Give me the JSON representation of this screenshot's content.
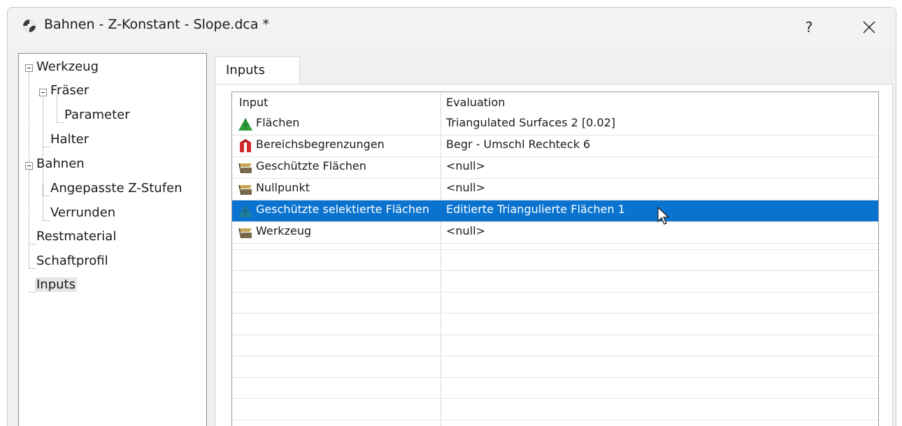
{
  "window": {
    "title": "Bahnen - Z-Konstant - Slope.dca *",
    "help_label": "?"
  },
  "tree": {
    "items": [
      {
        "label": "Werkzeug"
      },
      {
        "label": "Fräser"
      },
      {
        "label": "Parameter"
      },
      {
        "label": "Halter"
      },
      {
        "label": "Bahnen"
      },
      {
        "label": "Angepasste Z-Stufen"
      },
      {
        "label": "Verrunden"
      },
      {
        "label": "Restmaterial"
      },
      {
        "label": "Schaftprofil"
      },
      {
        "label": "Inputs"
      }
    ],
    "selected": "Inputs"
  },
  "tabs": [
    {
      "label": "Inputs"
    }
  ],
  "grid": {
    "columns": [
      "Input",
      "Evaluation"
    ],
    "rows": [
      {
        "input": "Flächen",
        "evaluation": "Triangulated Surfaces 2 [0.02]",
        "icon": "green-triangle-surface-icon"
      },
      {
        "input": "Bereichsbegrenzungen",
        "evaluation": "Begr - Umschl Rechteck 6",
        "icon": "boundary-icon"
      },
      {
        "input": "Geschützte Flächen",
        "evaluation": "<null>",
        "icon": "null-input-icon"
      },
      {
        "input": "Nullpunkt",
        "evaluation": "<null>",
        "icon": "null-input-icon"
      },
      {
        "input": "Geschützte selektierte Flächen",
        "evaluation": "Editierte Triangulierte Flächen 1",
        "icon": "teal-triangle-surface-icon"
      },
      {
        "input": "Werkzeug",
        "evaluation": "<null>",
        "icon": "null-input-icon"
      }
    ],
    "selected_row": 4
  },
  "colors": {
    "selection": "#0a73d0",
    "green_icon": "#2e9e3a",
    "red_icon": "#d42a2a",
    "teal_icon": "#1f7fa0"
  }
}
